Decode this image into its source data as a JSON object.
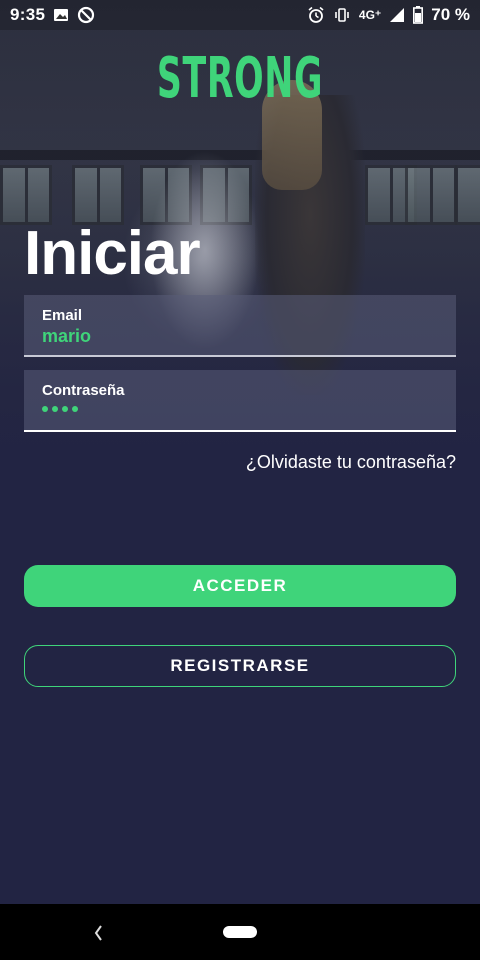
{
  "status_bar": {
    "time": "9:35",
    "left_icons": [
      "image-icon",
      "do-not-disturb-icon"
    ],
    "right_icons": [
      "alarm-icon",
      "vibrate-icon",
      "signal-icon",
      "battery-icon"
    ],
    "network": "4G⁺",
    "battery": "70 %"
  },
  "brand": {
    "logo_text": "STRONG",
    "accent_color": "#3fd47a"
  },
  "login": {
    "title": "Iniciar",
    "email": {
      "label": "Email",
      "value": "mario"
    },
    "password": {
      "label": "Contraseña",
      "masked_length": 4
    },
    "forgot_link": "¿Olvidaste tu contraseña?",
    "primary_button": "ACCEDER",
    "secondary_button": "REGISTRARSE"
  },
  "nav_bar": {
    "icons": [
      "back-icon",
      "home-pill-icon"
    ]
  },
  "colors": {
    "background": "#222443",
    "accent": "#3fd47a"
  }
}
